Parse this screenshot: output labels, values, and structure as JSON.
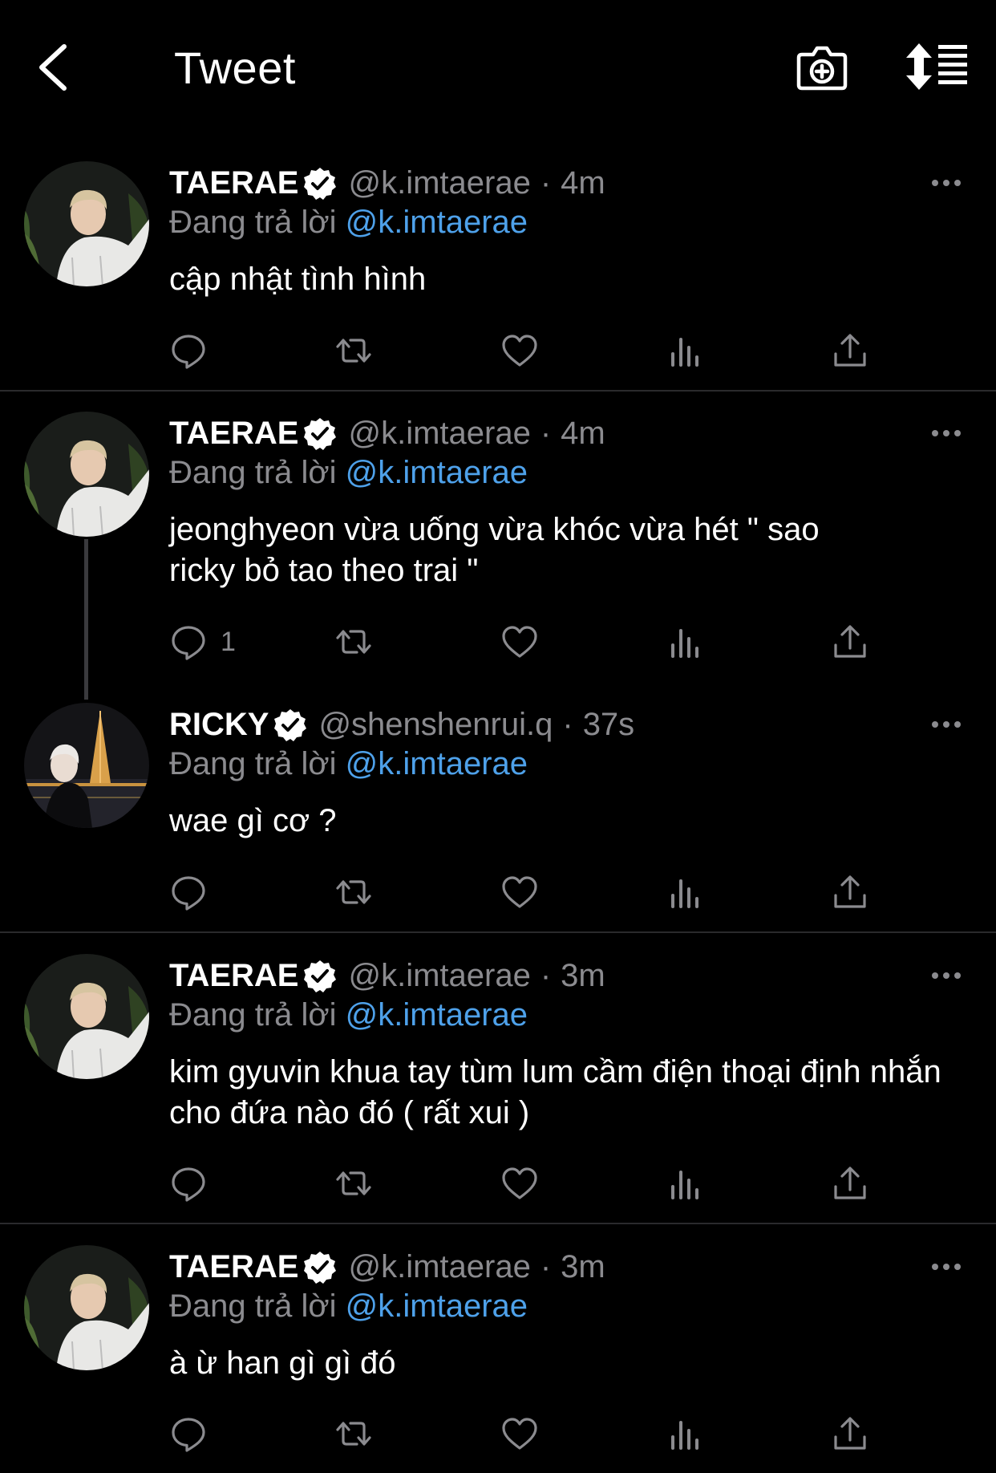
{
  "header": {
    "title": "Tweet",
    "back_icon": "chevron-left-icon",
    "camera_icon": "camera-plus-icon",
    "sort_icon": "sort-icon"
  },
  "tweets": [
    {
      "name": "TAERAE",
      "handle": "@k.imtaerae",
      "time": "4m",
      "reply_prefix": "Đang trả lời",
      "reply_handle": "@k.imtaerae",
      "text": "cập nhật tình hình",
      "reply_count": ""
    },
    {
      "name": "TAERAE",
      "handle": "@k.imtaerae",
      "time": "4m",
      "reply_prefix": "Đang trả lời",
      "reply_handle": "@k.imtaerae",
      "text": "jeonghyeon vừa uống vừa khóc vừa hét \" sao ricky bỏ tao theo trai \"",
      "reply_count": "1"
    },
    {
      "name": "RICKY",
      "handle": "@shenshenrui.q",
      "time": "37s",
      "reply_prefix": "Đang trả lời",
      "reply_handle": "@k.imtaerae",
      "text": "wae gì cơ ?",
      "reply_count": ""
    },
    {
      "name": "TAERAE",
      "handle": "@k.imtaerae",
      "time": "3m",
      "reply_prefix": "Đang trả lời",
      "reply_handle": "@k.imtaerae",
      "text": "kim gyuvin khua tay tùm lum cầm điện thoại định nhắn cho đứa nào đó ( rất xui )",
      "reply_count": ""
    },
    {
      "name": "TAERAE",
      "handle": "@k.imtaerae",
      "time": "3m",
      "reply_prefix": "Đang trả lời",
      "reply_handle": "@k.imtaerae",
      "text": "à ừ han gì gì đó",
      "reply_count": ""
    }
  ],
  "colors": {
    "background": "#000000",
    "secondary_text": "#8b8b8f",
    "mention": "#4ea1ea",
    "divider": "#2a2a2c"
  }
}
